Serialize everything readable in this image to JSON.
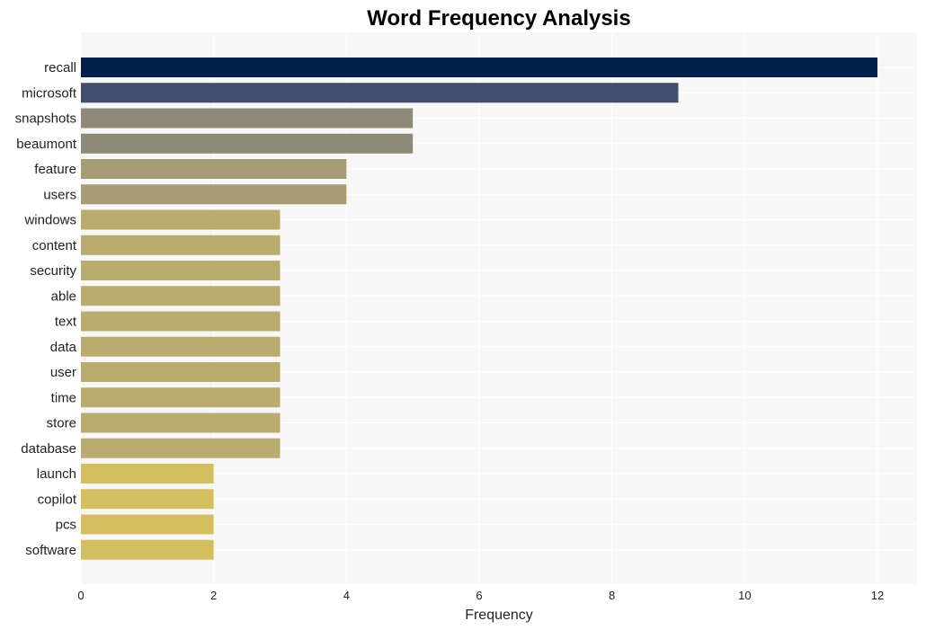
{
  "chart_data": {
    "type": "bar",
    "orientation": "horizontal",
    "title": "Word Frequency Analysis",
    "xlabel": "Frequency",
    "ylabel": "",
    "xlim": [
      0,
      12.6
    ],
    "xticks": [
      0,
      2,
      4,
      6,
      8,
      10,
      12
    ],
    "grid": true,
    "categories": [
      "recall",
      "microsoft",
      "snapshots",
      "beaumont",
      "feature",
      "users",
      "windows",
      "content",
      "security",
      "able",
      "text",
      "data",
      "user",
      "time",
      "store",
      "database",
      "launch",
      "copilot",
      "pcs",
      "software"
    ],
    "values": [
      12,
      9,
      5,
      5,
      4,
      4,
      3,
      3,
      3,
      3,
      3,
      3,
      3,
      3,
      3,
      3,
      2,
      2,
      2,
      2
    ],
    "colors": [
      "#00204c",
      "#434e6c",
      "#8f8a77",
      "#8f8a77",
      "#a59b74",
      "#a59b74",
      "#baac6e",
      "#baac6e",
      "#baac6e",
      "#baac6e",
      "#baac6e",
      "#baac6e",
      "#baac6e",
      "#baac6e",
      "#baac6e",
      "#baac6e",
      "#d3bf5f",
      "#d3bf5f",
      "#d3bf5f",
      "#d3bf5f"
    ],
    "plot_background": "#f7f7f7"
  }
}
